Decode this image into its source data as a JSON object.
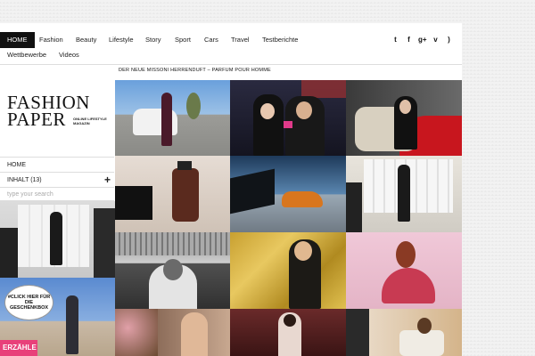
{
  "nav": {
    "items": [
      "HOME",
      "Fashion",
      "Beauty",
      "Lifestyle",
      "Story",
      "Sport",
      "Cars",
      "Travel",
      "Testberichte"
    ],
    "items2": [
      "Wettbewerbe",
      "Videos"
    ],
    "social": [
      "twitter-icon",
      "facebook-icon",
      "google-plus-icon",
      "vimeo-icon",
      "rss-icon"
    ]
  },
  "headline": "DER NEUE MISSONI HERRENDUFT – PARFUM POUR HOMME",
  "logo": {
    "line1": "FASHION",
    "line2": "PAPER",
    "tagline": "ONLINE LIFESTYLE MAGAZIN"
  },
  "sidebar": {
    "home": "HOME",
    "inhalt": "INHALT (13)",
    "search_placeholder": "type your search"
  },
  "promo": {
    "bubble": "#CLICK HIER FÜR DIE GESCHENKBOX",
    "badge": "ERZÄHLE"
  },
  "colors": {
    "active_nav": "#111111",
    "badge": "#e8407a"
  }
}
